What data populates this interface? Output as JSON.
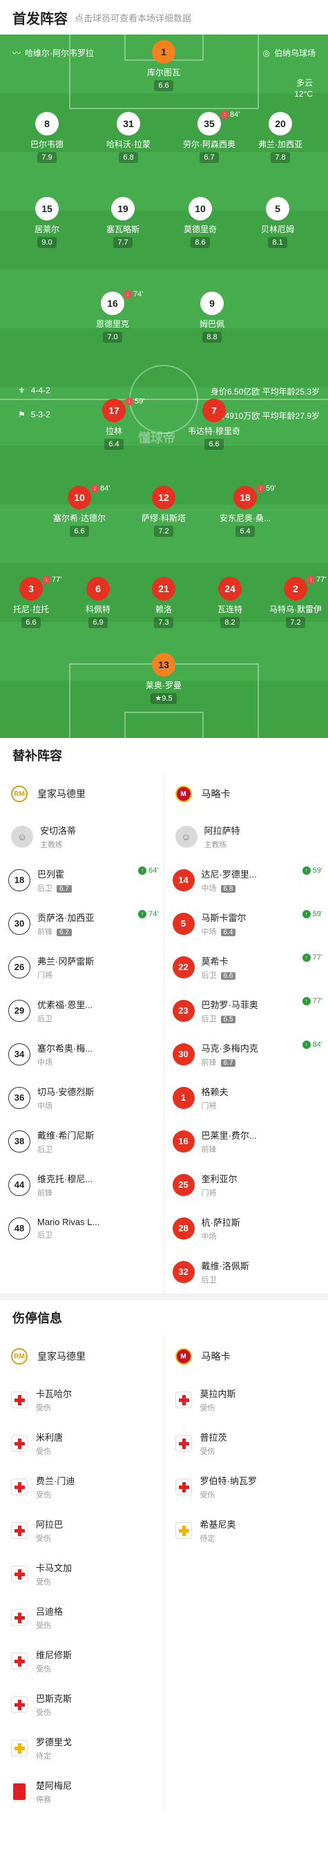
{
  "header": {
    "title": "首发阵容",
    "subtitle": "点击球员可查看本场详细数据"
  },
  "match": {
    "referee": "哈维尔·阿尔韦罗拉",
    "venue": "伯纳乌球场",
    "weather": "多云",
    "temp": "12°C",
    "watermark": "懂球帝"
  },
  "home_formation": {
    "formation": "4-4-2",
    "value": "身价6.50亿欧",
    "age": "平均年龄25.3岁"
  },
  "away_formation": {
    "formation": "5-3-2",
    "value": "身价4910万欧",
    "age": "平均年龄27.9岁"
  },
  "home_players": [
    {
      "num": "1",
      "name": "库尔图瓦",
      "rating": "6.6",
      "gk": true
    },
    {
      "num": "8",
      "name": "巴尔韦德",
      "rating": "7.9"
    },
    {
      "num": "31",
      "name": "哈科沃·拉蒙",
      "rating": "6.8",
      "goal": true
    },
    {
      "num": "35",
      "name": "劳尔·阿森西奥",
      "rating": "6.7",
      "sub": "84'"
    },
    {
      "num": "20",
      "name": "弗兰·加西亚",
      "rating": "7.8"
    },
    {
      "num": "15",
      "name": "居莱尔",
      "rating": "9.0",
      "high": true
    },
    {
      "num": "19",
      "name": "塞瓦略斯",
      "rating": "7.7"
    },
    {
      "num": "10",
      "name": "莫德里奇",
      "rating": "8.6",
      "captain": true,
      "goal": true
    },
    {
      "num": "5",
      "name": "贝林厄姆",
      "rating": "8.1"
    },
    {
      "num": "16",
      "name": "恩德里克",
      "rating": "7.0",
      "sub": "74'"
    },
    {
      "num": "9",
      "name": "姆巴佩",
      "rating": "8.8",
      "goal": true
    }
  ],
  "away_players": [
    {
      "num": "17",
      "name": "拉林",
      "rating": "6.4",
      "sub": "59'"
    },
    {
      "num": "7",
      "name": "韦达特·穆里奇",
      "rating": "6.6"
    },
    {
      "num": "10",
      "name": "塞尔希·达德尔",
      "rating": "6.6",
      "sub": "84'"
    },
    {
      "num": "12",
      "name": "萨缪·科斯塔",
      "rating": "7.2",
      "card": true
    },
    {
      "num": "18",
      "name": "安东尼奥·桑...",
      "rating": "6.4",
      "sub": "59'",
      "card": true
    },
    {
      "num": "3",
      "name": "托尼·拉托",
      "rating": "6.6",
      "sub": "77'"
    },
    {
      "num": "6",
      "name": "科佩特",
      "rating": "6.9"
    },
    {
      "num": "21",
      "name": "赖洛",
      "rating": "7.3",
      "captain": true
    },
    {
      "num": "24",
      "name": "瓦连特",
      "rating": "8.2",
      "goal": true
    },
    {
      "num": "2",
      "name": "马特乌·默雷伊",
      "rating": "7.2",
      "sub": "77'"
    },
    {
      "num": "13",
      "name": "莱奥·罗曼",
      "rating": "9.5",
      "gk": true,
      "star": true
    }
  ],
  "subs_title": "替补阵容",
  "home_team": "皇家马德里",
  "away_team": "马略卡",
  "home_coach": {
    "name": "安切洛蒂",
    "role": "主教练"
  },
  "away_coach": {
    "name": "阿拉萨特",
    "role": "主教练"
  },
  "home_subs": [
    {
      "num": "18",
      "name": "巴列霍",
      "pos": "后卫",
      "rating": "6.7",
      "sub": "64'"
    },
    {
      "num": "30",
      "name": "贡萨洛·加西亚",
      "pos": "前锋",
      "rating": "6.2",
      "sub": "74'"
    },
    {
      "num": "26",
      "name": "弗兰·冈萨雷斯",
      "pos": "门将"
    },
    {
      "num": "29",
      "name": "优素福·恩里...",
      "pos": "后卫"
    },
    {
      "num": "34",
      "name": "塞尔希奥·梅...",
      "pos": "中场"
    },
    {
      "num": "36",
      "name": "切马·安德烈斯",
      "pos": "中场"
    },
    {
      "num": "38",
      "name": "戴维·希门尼斯",
      "pos": "后卫"
    },
    {
      "num": "44",
      "name": "维克托·穆尼...",
      "pos": "前锋"
    },
    {
      "num": "48",
      "name": "Mario Rivas L...",
      "pos": "后卫"
    }
  ],
  "away_subs": [
    {
      "num": "14",
      "name": "达尼·罗德里...",
      "pos": "中场",
      "rating": "6.8",
      "sub": "59'"
    },
    {
      "num": "5",
      "name": "马斯卡雷尔",
      "pos": "中场",
      "rating": "6.4",
      "sub": "59'"
    },
    {
      "num": "22",
      "name": "莫希卡",
      "pos": "后卫",
      "rating": "6.6",
      "sub": "77'"
    },
    {
      "num": "23",
      "name": "巴勃罗·马菲奥",
      "pos": "后卫",
      "rating": "6.5",
      "sub": "77'"
    },
    {
      "num": "30",
      "name": "马克·多梅内克",
      "pos": "前锋",
      "rating": "6.7",
      "sub": "84'"
    },
    {
      "num": "1",
      "name": "格赖夫",
      "pos": "门将"
    },
    {
      "num": "16",
      "name": "巴莱里·费尔...",
      "pos": "前锋"
    },
    {
      "num": "25",
      "name": "奎利亚尔",
      "pos": "门将"
    },
    {
      "num": "28",
      "name": "杭·萨拉斯",
      "pos": "中场"
    },
    {
      "num": "32",
      "name": "戴维·洛佩斯",
      "pos": "后卫"
    }
  ],
  "injury_title": "伤停信息",
  "home_injuries": [
    {
      "name": "卡瓦哈尔",
      "status": "受伤",
      "type": "med"
    },
    {
      "name": "米利唐",
      "status": "受伤",
      "type": "med"
    },
    {
      "name": "费兰·门迪",
      "status": "受伤",
      "type": "med"
    },
    {
      "name": "阿拉巴",
      "status": "受伤",
      "type": "med"
    },
    {
      "name": "卡马文加",
      "status": "受伤",
      "type": "med"
    },
    {
      "name": "吕迪格",
      "status": "受伤",
      "type": "med"
    },
    {
      "name": "维尼修斯",
      "status": "受伤",
      "type": "med"
    },
    {
      "name": "巴斯克斯",
      "status": "受伤",
      "type": "med"
    },
    {
      "name": "罗德里戈",
      "status": "待定",
      "type": "yellow"
    },
    {
      "name": "楚阿梅尼",
      "status": "停赛",
      "type": "red"
    }
  ],
  "away_injuries": [
    {
      "name": "莫拉内斯",
      "status": "受伤",
      "type": "med"
    },
    {
      "name": "普拉茨",
      "status": "受伤",
      "type": "med"
    },
    {
      "name": "罗伯特·纳瓦罗",
      "status": "受伤",
      "type": "med"
    },
    {
      "name": "希基尼奥",
      "status": "待定",
      "type": "yellow"
    }
  ]
}
